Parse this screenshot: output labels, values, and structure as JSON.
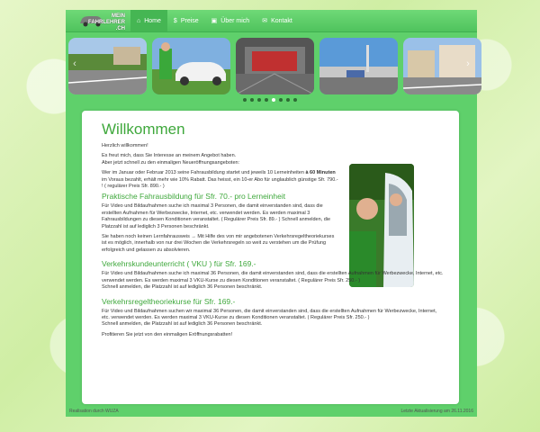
{
  "logo": {
    "line1": "MEIN",
    "line2": "FAHRLEHRER",
    "line3": ".CH"
  },
  "nav": [
    {
      "icon": "⌂",
      "label": "Home",
      "active": true
    },
    {
      "icon": "$",
      "label": "Preise",
      "active": false
    },
    {
      "icon": "▣",
      "label": "Über mich",
      "active": false
    },
    {
      "icon": "✉",
      "label": "Kontakt",
      "active": false
    }
  ],
  "carousel": {
    "dots": 8,
    "active_dot": 4
  },
  "main": {
    "title": "Willkommen",
    "greeting": "Herzlich willkommen!",
    "intro1": "Es freut mich, dass Sie Interesse an meinem Angebot haben.",
    "intro2": "Aber jetzt schnell zu den einmaligen Neueröffnungsangeboten:",
    "offer_pre": "Wer im Januar oder Februar 2013 seine Fahrausbildung startet und jeweils 10 Lerneinheiten",
    "offer_bold": "à 60 Minuten",
    "offer_post": " im Voraus bezahlt, erhält mehr wie 10% Rabatt. Das heisst, ein 10-er Abo für unglaublich günstige Sfr. 790.- ! ( regulärer Preis Sfr. 890.- )",
    "h_praktisch": "Praktische Fahrausbildung für Sfr. 70.- pro Lerneinheit",
    "p_praktisch": "Für Video und Bildaufnahmen suche ich maximal 3 Personen, die damit einverstanden sind, dass die erstellten Aufnahmen für Werbezwecke, Internet, etc. verwendet werden. Es werden maximal 3 Fahrausbildungen zu diesen Konditionen veranstaltet. ( Regulärer Preis Sfr. 89.- ) Schnell anmelden, die Platzzahl ist auf lediglich 3 Personen beschränkt.",
    "p_lernfahr": "Sie haben noch keinen Lernfahrausweis    →    Mit Hilfe des von mir angebotenen Verkehrsregeltheoriekurses ist es möglich, innerhalb von nur drei Wochen die Verkehrsregeln so weit zu verstehen um die Prüfung erfolgreich und gelassen zu absolvieren.",
    "h_vku": "Verkehrskundeunterricht ( VKU ) für  Sfr. 169.-",
    "p_vku1": "Für Video und Bildaufnahmen suche ich maximal 36 Personen, die damit einverstanden sind, dass die erstellten Aufnahmen für Werbezwecke, Internet, etc. verwendet werden. Es werden maximal 3 VKU-Kurse zu diesen Konditionen veranstaltet. ( Regulärer Preis Sfr. 250.- )",
    "p_vku2": "Schnell anmelden, die Platzzahl ist auf lediglich 36 Personen beschränkt.",
    "h_theorie": "Verkehrsregeltheoriekurse für Sfr.  169.-",
    "p_theorie1": "Für Video und Bildaufnahmen suchen wir  maximal 36 Personen, die damit einverstanden sind, dass die erstellten Aufnahmen für Werbezwecke, Internet, etc. verwendet werden. Es werden maximal 3 VKU-Kurse zu diesen Konditionen veranstaltet. ( Regulärer Preis Sfr. 250.- )",
    "p_theorie2": "Schnell anmelden, die Platzzahl ist auf lediglich 36 Personen beschränkt.",
    "closing": "Profitieren Sie jetzt von den einmaligen Eröffnungsrabatten!"
  },
  "footer": {
    "left": "Realisation durch WUZA",
    "right": "Letzte Aktualisierung am 26.11.2016"
  },
  "colors": {
    "brand_green": "#5fd06b",
    "heading_green": "#3fa83c",
    "nav_active": "#45b653"
  },
  "icons": {
    "nav": [
      "home-icon",
      "dollar-icon",
      "user-card-icon",
      "mail-icon"
    ],
    "carousel": [
      "chevron-left-icon",
      "chevron-right-icon"
    ]
  }
}
